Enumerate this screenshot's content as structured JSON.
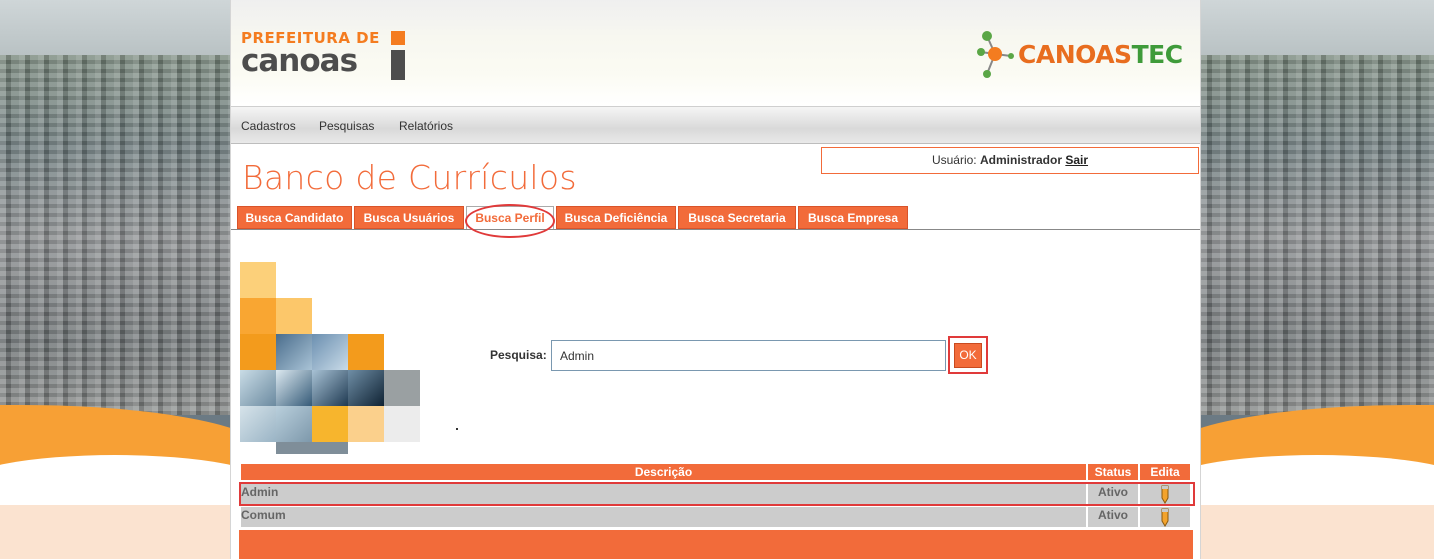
{
  "header": {
    "logo_left_top": "PREFEITURA DE",
    "logo_left_bottom": "canoas",
    "logo_right_canoas": "CANOAS",
    "logo_right_tec": "TEC"
  },
  "menu": [
    "Cadastros",
    "Pesquisas",
    "Relatórios"
  ],
  "user": {
    "label": "Usuário:",
    "name": "Administrador",
    "logout": "Sair"
  },
  "page_title": "Banco de Currículos",
  "tabs": [
    {
      "label": "Busca Candidato"
    },
    {
      "label": "Busca Usuários"
    },
    {
      "label": "Busca Perfil"
    },
    {
      "label": "Busca Deficiência"
    },
    {
      "label": "Busca Secretaria"
    },
    {
      "label": "Busca Empresa"
    }
  ],
  "search": {
    "label": "Pesquisa:",
    "value": "Admin",
    "button": "OK"
  },
  "table": {
    "headers": [
      "Descrição",
      "Status",
      "Edita"
    ],
    "rows": [
      {
        "descricao": "Admin",
        "status": "Ativo",
        "edit_icon": "pencil-icon"
      },
      {
        "descricao": "Comum",
        "status": "Ativo",
        "edit_icon": "pencil-icon"
      }
    ]
  },
  "colors": {
    "accent": "#f26b3a",
    "annotation": "#e03a3a",
    "row_bg": "#cccccc"
  }
}
